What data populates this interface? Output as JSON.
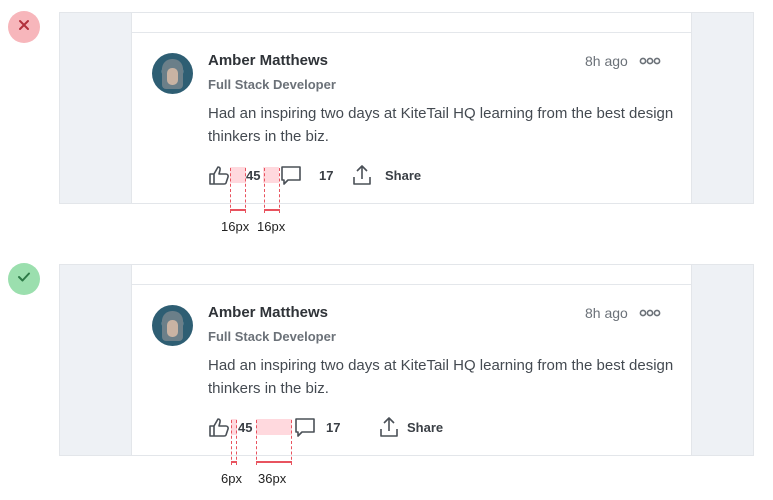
{
  "colors": {
    "bad_status": "#f7b6bb",
    "good_status": "#9bdfae",
    "highlight": "#ffd9de",
    "measure_line": "#e8535f"
  },
  "status_icons": {
    "bad": "x-icon",
    "good": "check-icon"
  },
  "examples": [
    {
      "status": "incorrect",
      "post": {
        "author": "Amber Matthews",
        "role": "Full Stack Developer",
        "time": "8h ago",
        "text": "Had an inspiring two days at KiteTail HQ learning from the best design thinkers in the biz.",
        "likes": "45",
        "comments": "17",
        "share_label": "Share"
      },
      "spacings": [
        "16px",
        "16px"
      ]
    },
    {
      "status": "correct",
      "post": {
        "author": "Amber Matthews",
        "role": "Full Stack Developer",
        "time": "8h ago",
        "text": "Had an inspiring two days at KiteTail HQ learning from the best design thinkers in the biz.",
        "likes": "45",
        "comments": "17",
        "share_label": "Share"
      },
      "spacings": [
        "6px",
        "36px"
      ]
    }
  ]
}
